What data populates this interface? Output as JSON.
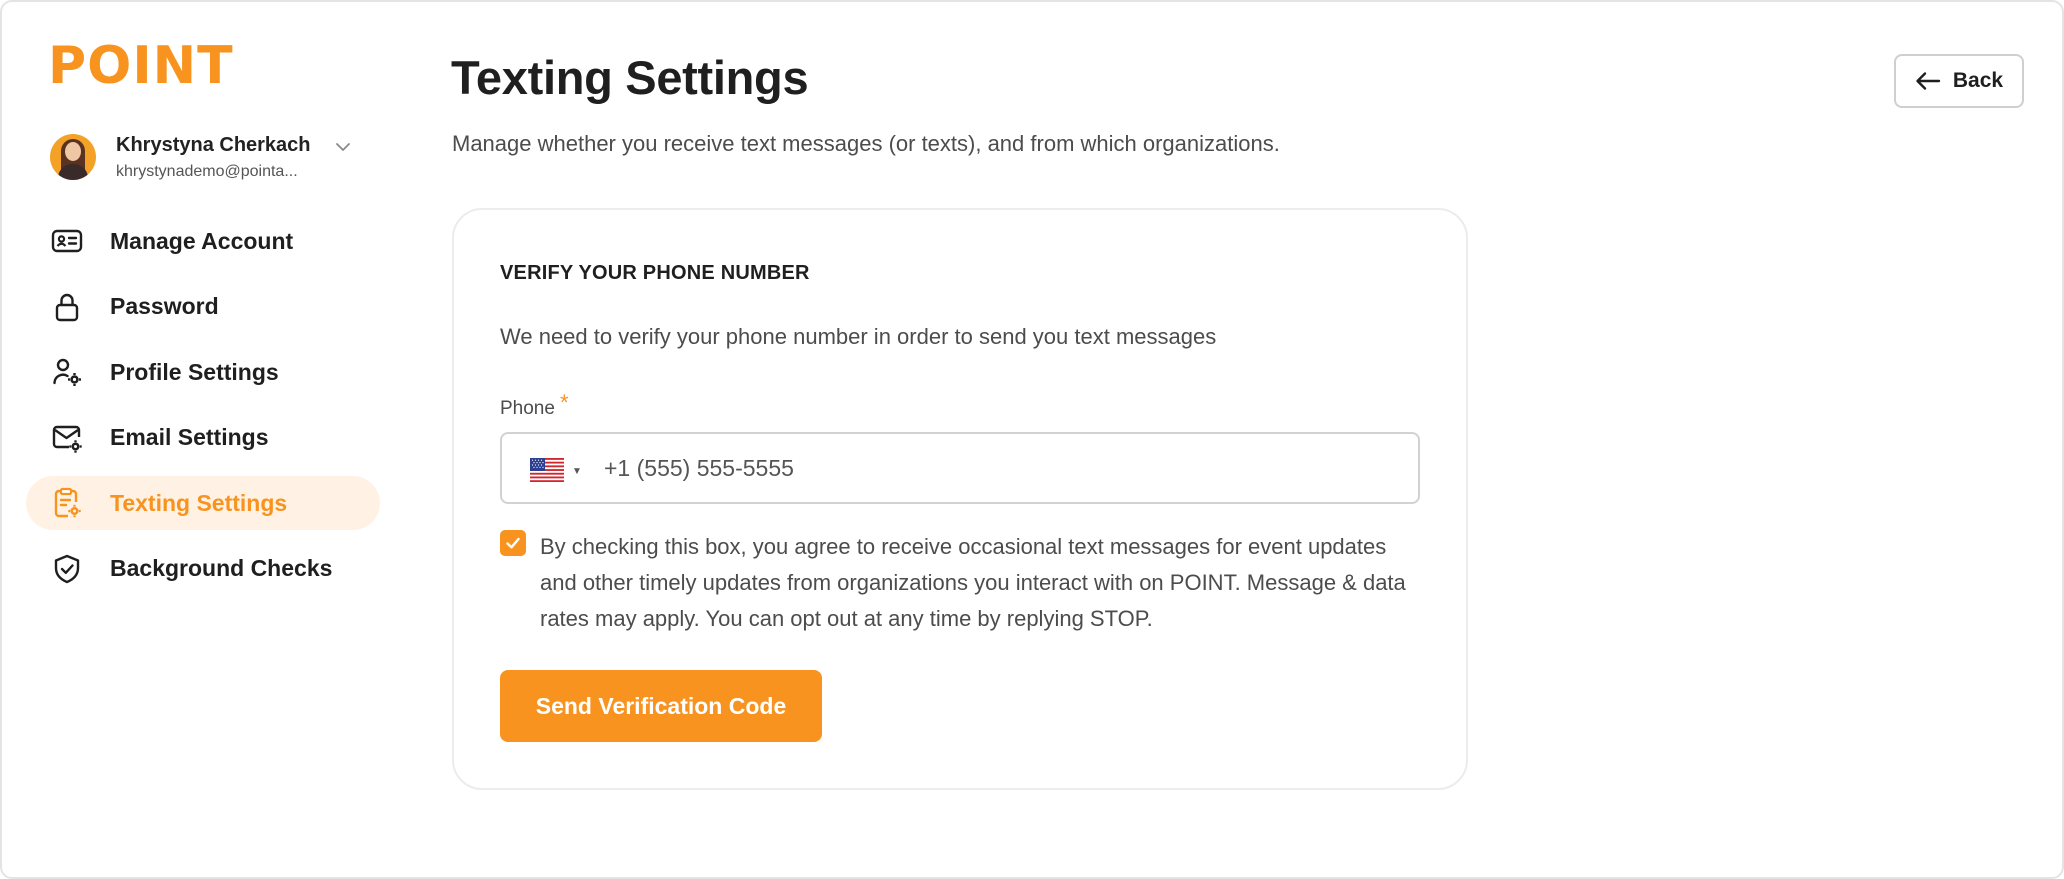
{
  "brand": {
    "logo_text": "POINT",
    "accent": "#f7931e"
  },
  "user": {
    "name": "Khrystyna Cherkach",
    "email": "khrystynademo@pointa..."
  },
  "sidebar": {
    "items": [
      {
        "label": "Manage Account",
        "icon": "id-card-icon",
        "active": false
      },
      {
        "label": "Password",
        "icon": "lock-icon",
        "active": false
      },
      {
        "label": "Profile Settings",
        "icon": "user-gear-icon",
        "active": false
      },
      {
        "label": "Email Settings",
        "icon": "mail-gear-icon",
        "active": false
      },
      {
        "label": "Texting Settings",
        "icon": "clipboard-gear-icon",
        "active": true
      },
      {
        "label": "Background Checks",
        "icon": "shield-check-icon",
        "active": false
      }
    ]
  },
  "header": {
    "title": "Texting Settings",
    "subtitle": "Manage whether you receive text messages (or texts), and from which organizations.",
    "back_label": "Back"
  },
  "verify": {
    "heading": "VERIFY YOUR PHONE NUMBER",
    "description": "We need to verify your phone number in order to send you text messages",
    "phone_label": "Phone",
    "required_mark": "*",
    "phone_placeholder": "+1 (555) 555-5555",
    "country_flag": "us-flag-icon",
    "consent_checked": true,
    "consent_text": "By checking this box, you agree to receive occasional text messages for event updates and other timely updates from organizations you interact with on POINT. Message & data rates may apply. You can opt out at any time by replying STOP.",
    "send_button": "Send Verification Code"
  }
}
